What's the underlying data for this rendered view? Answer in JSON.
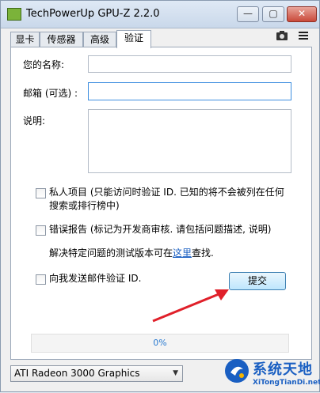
{
  "window": {
    "title": "TechPowerUp GPU-Z 2.2.0"
  },
  "tabs": [
    {
      "label": "显卡"
    },
    {
      "label": "传感器"
    },
    {
      "label": "高级"
    },
    {
      "label": "验证"
    }
  ],
  "form": {
    "name_label": "您的名称:",
    "name_value": "",
    "email_label": "邮箱 (可选) :",
    "email_value": "",
    "comment_label": "说明:",
    "comment_value": "",
    "private_label": "私人项目 (只能访问时验证 ID. 已知的将不会被列在任何搜索或排行榜中)",
    "bugreport_label": "错误报告 (标记为开发商审核. 请包括问题描述, 说明)",
    "test_note_prefix": "解决特定问题的测试版本可在",
    "test_note_link": "这里",
    "test_note_suffix": "查找.",
    "send_email_label": "向我发送邮件验证 ID.",
    "submit_label": "提交"
  },
  "progress": {
    "label": "0%",
    "value": 0
  },
  "gpu_select": {
    "value": "ATI Radeon 3000 Graphics"
  },
  "watermark": {
    "title": "系统天地",
    "subtitle": "XiTongTianDi.net"
  },
  "colors": {
    "accent": "#1a5fc2",
    "arrow": "#e0202a",
    "close": "#c9493a"
  }
}
